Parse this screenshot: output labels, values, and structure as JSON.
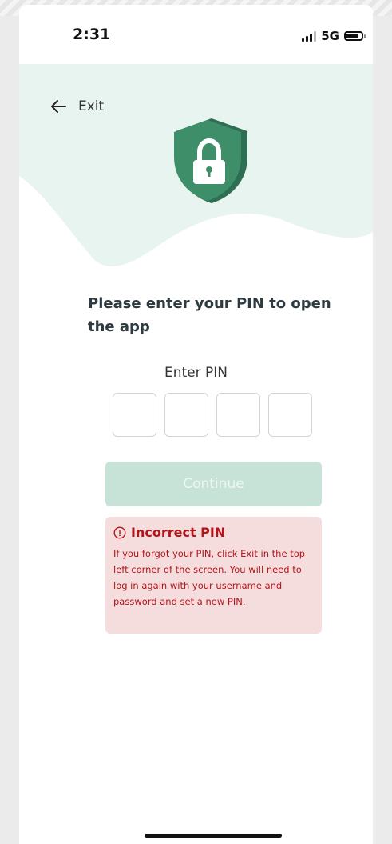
{
  "status_bar": {
    "time": "2:31",
    "network": "5G",
    "icons": [
      "signal-icon",
      "battery-icon"
    ]
  },
  "header": {
    "back_label": "Exit",
    "back_icon": "arrow-left-icon",
    "emblem_icon": "shield-lock-icon"
  },
  "main": {
    "title": "Please enter your PIN to open the app",
    "pin_label": "Enter PIN",
    "pin_digits": [
      "",
      "",
      "",
      ""
    ],
    "continue_label": "Continue"
  },
  "error": {
    "title": "Incorrect PIN",
    "icon": "alert-circle-icon",
    "message": "If you forgot your PIN, click Exit in the top left corner of the screen. You will need to log in again with your username and password and set a new PIN."
  },
  "colors": {
    "header_bg": "#e8f4ef",
    "shield_green": "#3f8e6a",
    "button_disabled": "#c7e2d6",
    "error_bg": "#f6dddd",
    "error_text": "#b3141a"
  }
}
